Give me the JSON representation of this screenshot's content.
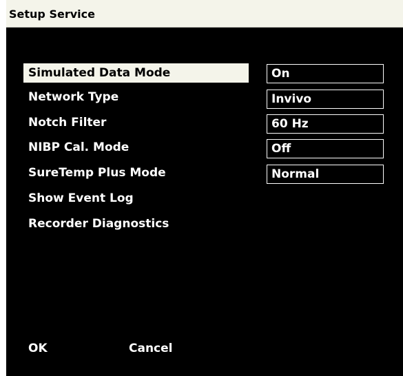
{
  "window": {
    "title": "Setup Service"
  },
  "menu": {
    "items": [
      {
        "label": "Simulated Data Mode",
        "value": "On",
        "selected": true
      },
      {
        "label": "Network Type",
        "value": "Invivo"
      },
      {
        "label": "Notch Filter",
        "value": "60 Hz"
      },
      {
        "label": "NIBP Cal. Mode",
        "value": "Off"
      },
      {
        "label": "SureTemp Plus Mode",
        "value": "Normal"
      },
      {
        "label": "Show Event Log"
      },
      {
        "label": "Recorder Diagnostics"
      }
    ]
  },
  "footer": {
    "ok_label": "OK",
    "cancel_label": "Cancel"
  },
  "colors": {
    "background": "#000000",
    "text": "#ffffff",
    "selection": "#f4f4ea",
    "titlebar": "#f4f4ea"
  }
}
